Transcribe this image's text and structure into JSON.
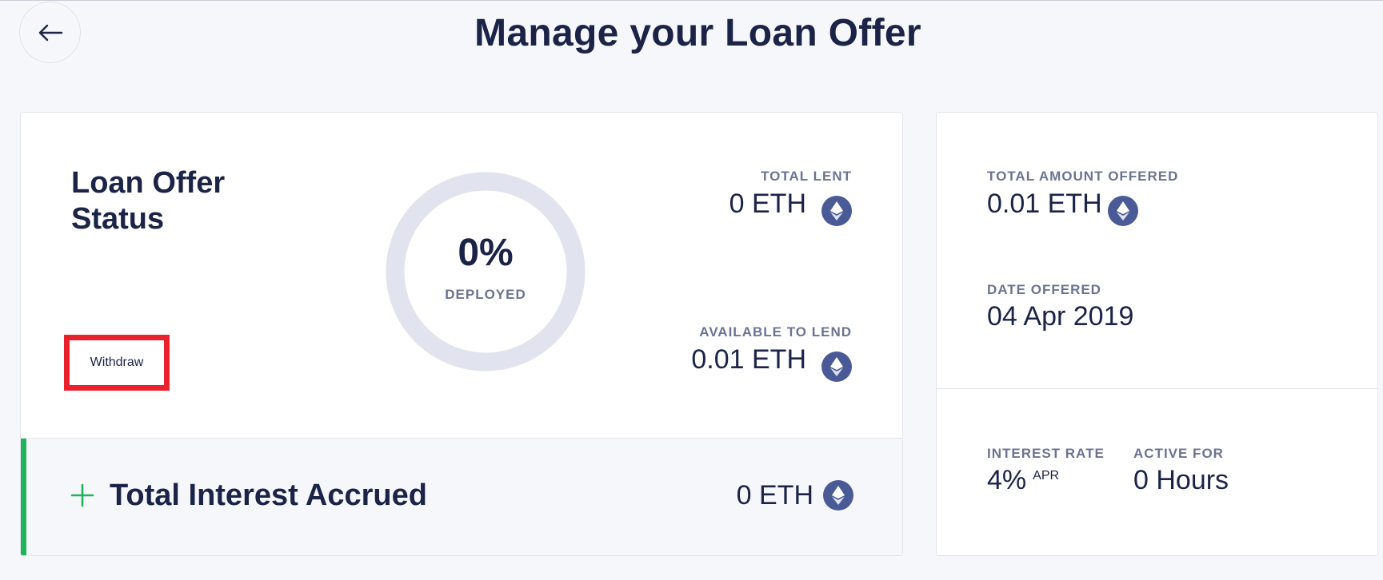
{
  "header": {
    "title": "Manage your Loan Offer",
    "back_icon": "arrow-left-icon"
  },
  "status": {
    "title_line1": "Loan Offer",
    "title_line2": "Status",
    "withdraw_label": "Withdraw",
    "deployed_percent": "0%",
    "deployed_label": "DEPLOYED",
    "deployed_fraction": 0
  },
  "lending": {
    "total_lent_label": "TOTAL LENT",
    "total_lent_value": "0 ETH",
    "available_label": "AVAILABLE TO LEND",
    "available_value": "0.01 ETH"
  },
  "interest": {
    "label": "Total Interest Accrued",
    "value": "0 ETH"
  },
  "offer": {
    "amount_label": "TOTAL AMOUNT OFFERED",
    "amount_value": "0.01 ETH",
    "date_label": "DATE OFFERED",
    "date_value": "04 Apr 2019",
    "rate_label": "INTEREST RATE",
    "rate_value": "4%",
    "rate_unit": "APR",
    "active_label": "ACTIVE FOR",
    "active_value": "0 Hours"
  },
  "colors": {
    "accent_green": "#21b35b",
    "eth_icon_bg": "#4a5a96",
    "highlight_red": "#e8212c",
    "text_dark": "#1b2347"
  }
}
